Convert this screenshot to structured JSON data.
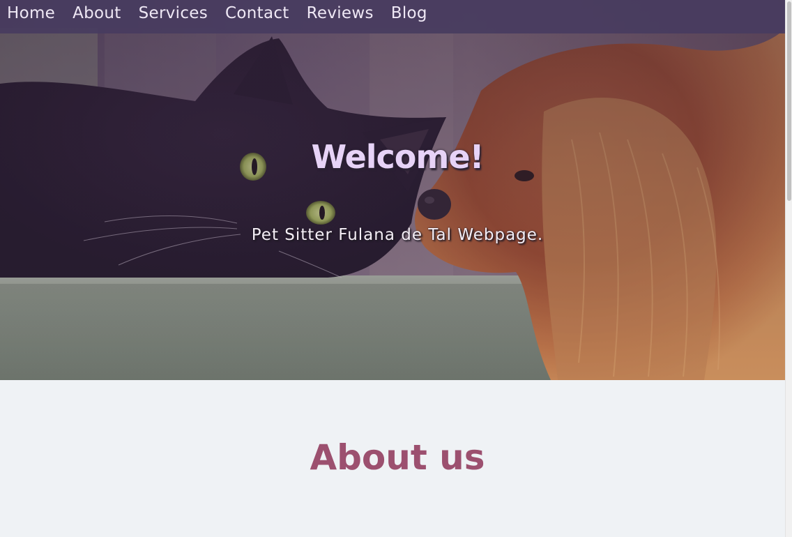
{
  "nav": {
    "links": [
      {
        "label": "Home"
      },
      {
        "label": "About"
      },
      {
        "label": "Services"
      },
      {
        "label": "Contact"
      },
      {
        "label": "Reviews"
      },
      {
        "label": "Blog"
      }
    ]
  },
  "hero": {
    "title": "Welcome!",
    "subtitle": "Pet Sitter Fulana de Tal Webpage.",
    "image": "black cat and long-haired brown dog resting on a ledge"
  },
  "about": {
    "heading": "About us"
  },
  "colors": {
    "nav_bg": "#483c60",
    "hero_title": "#e7d3f7",
    "about_heading": "#9c506f",
    "page_bg": "#eff2f5"
  }
}
